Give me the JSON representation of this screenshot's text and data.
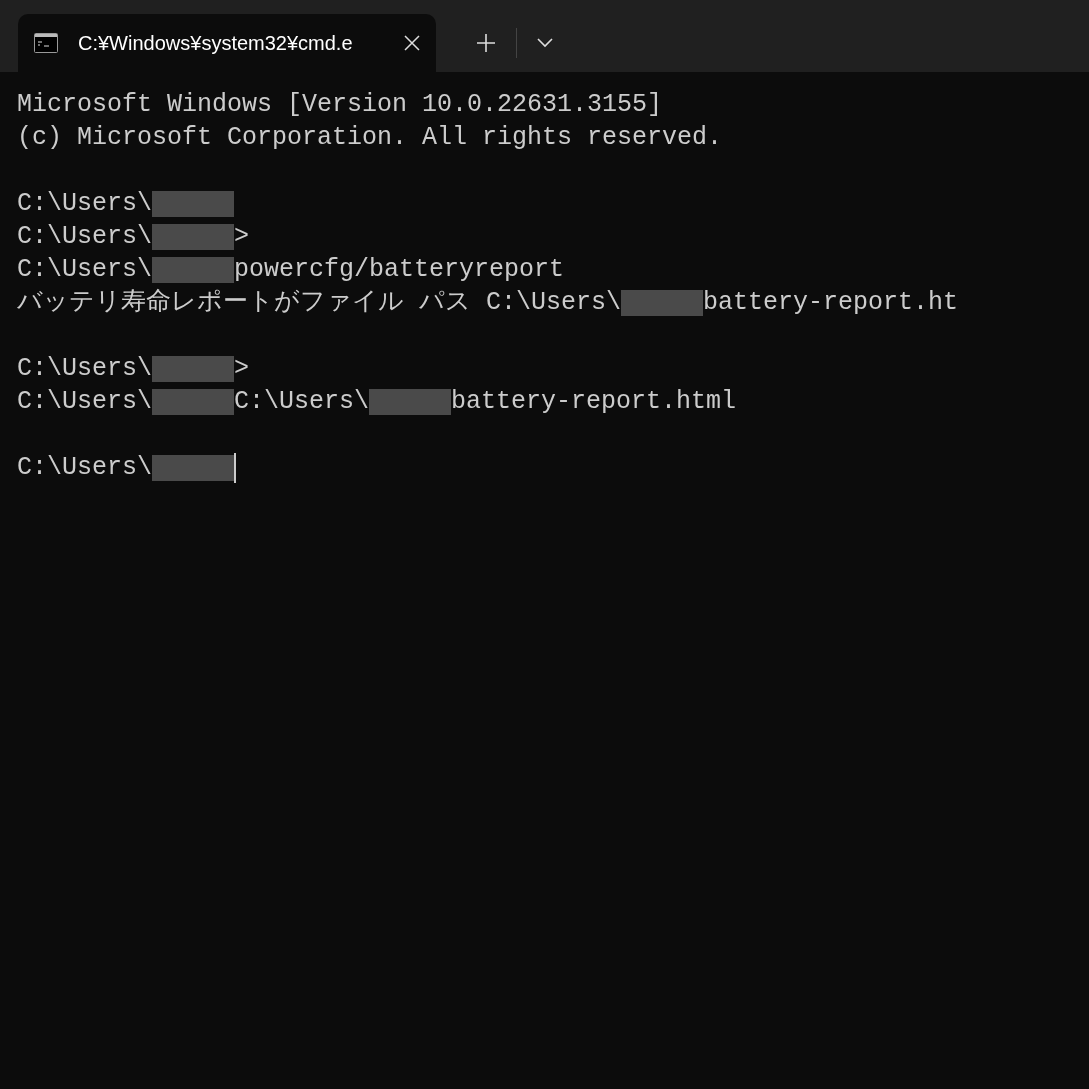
{
  "tab": {
    "title": "C:¥Windows¥system32¥cmd.e",
    "selected": true
  },
  "blocks": [
    {
      "lines": [
        {
          "parts": [
            {
              "kind": "text",
              "text": "Microsoft Windows [Version 10.0.22631.3155]"
            }
          ]
        },
        {
          "parts": [
            {
              "kind": "text",
              "text": "(c) Microsoft Corporation. All rights reserved."
            }
          ]
        }
      ]
    },
    {
      "lines": [
        {
          "parts": [
            {
              "kind": "text",
              "text": "C:\\Users\\"
            },
            {
              "kind": "redacted"
            }
          ]
        },
        {
          "parts": [
            {
              "kind": "text",
              "text": "C:\\Users\\"
            },
            {
              "kind": "redacted"
            },
            {
              "kind": "text",
              "text": ">"
            }
          ]
        },
        {
          "parts": [
            {
              "kind": "text",
              "text": "C:\\Users\\"
            },
            {
              "kind": "redacted"
            },
            {
              "kind": "text",
              "text": "powercfg/batteryreport"
            }
          ]
        },
        {
          "parts": [
            {
              "kind": "text",
              "text": "バッテリ寿命レポートがファイル パス C:\\Users\\"
            },
            {
              "kind": "redacted"
            },
            {
              "kind": "text",
              "text": "battery-report.ht"
            }
          ]
        }
      ]
    },
    {
      "lines": [
        {
          "parts": [
            {
              "kind": "text",
              "text": "C:\\Users\\"
            },
            {
              "kind": "redacted"
            },
            {
              "kind": "text",
              "text": ">"
            }
          ]
        },
        {
          "parts": [
            {
              "kind": "text",
              "text": "C:\\Users\\"
            },
            {
              "kind": "redacted"
            },
            {
              "kind": "text",
              "text": "C:\\Users\\"
            },
            {
              "kind": "redacted"
            },
            {
              "kind": "text",
              "text": "battery-report.html"
            }
          ]
        }
      ]
    },
    {
      "lines": [
        {
          "parts": [
            {
              "kind": "text",
              "text": "C:\\Users\\"
            },
            {
              "kind": "redacted"
            },
            {
              "kind": "cursor"
            }
          ]
        }
      ]
    }
  ]
}
